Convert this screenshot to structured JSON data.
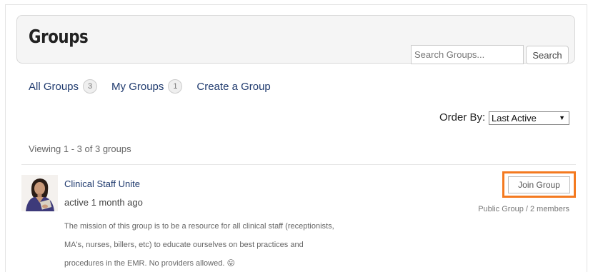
{
  "header": {
    "title": "Groups"
  },
  "search": {
    "placeholder": "Search Groups...",
    "button_label": "Search"
  },
  "nav": {
    "items": [
      {
        "label": "All Groups",
        "count": "3"
      },
      {
        "label": "My Groups",
        "count": "1"
      },
      {
        "label": "Create a Group"
      }
    ]
  },
  "order": {
    "label": "Order By:",
    "selected": "Last Active"
  },
  "pagination": {
    "count_text": "Viewing 1 - 3 of 3 groups"
  },
  "groups": [
    {
      "name": "Clinical Staff Unite",
      "activity": "active 1 month ago",
      "description": "The mission of this group is to be a resource for all clinical staff (receptionists, MA's, nurses, billers, etc) to educate ourselves on best practices and procedures in the EMR. No providers allowed. 😛",
      "join_label": "Join Group",
      "meta": "Public Group / 2 members"
    }
  ],
  "colors": {
    "link": "#1f3a6e",
    "highlight": "#f47a20",
    "header_bg": "#f5f5f5"
  }
}
